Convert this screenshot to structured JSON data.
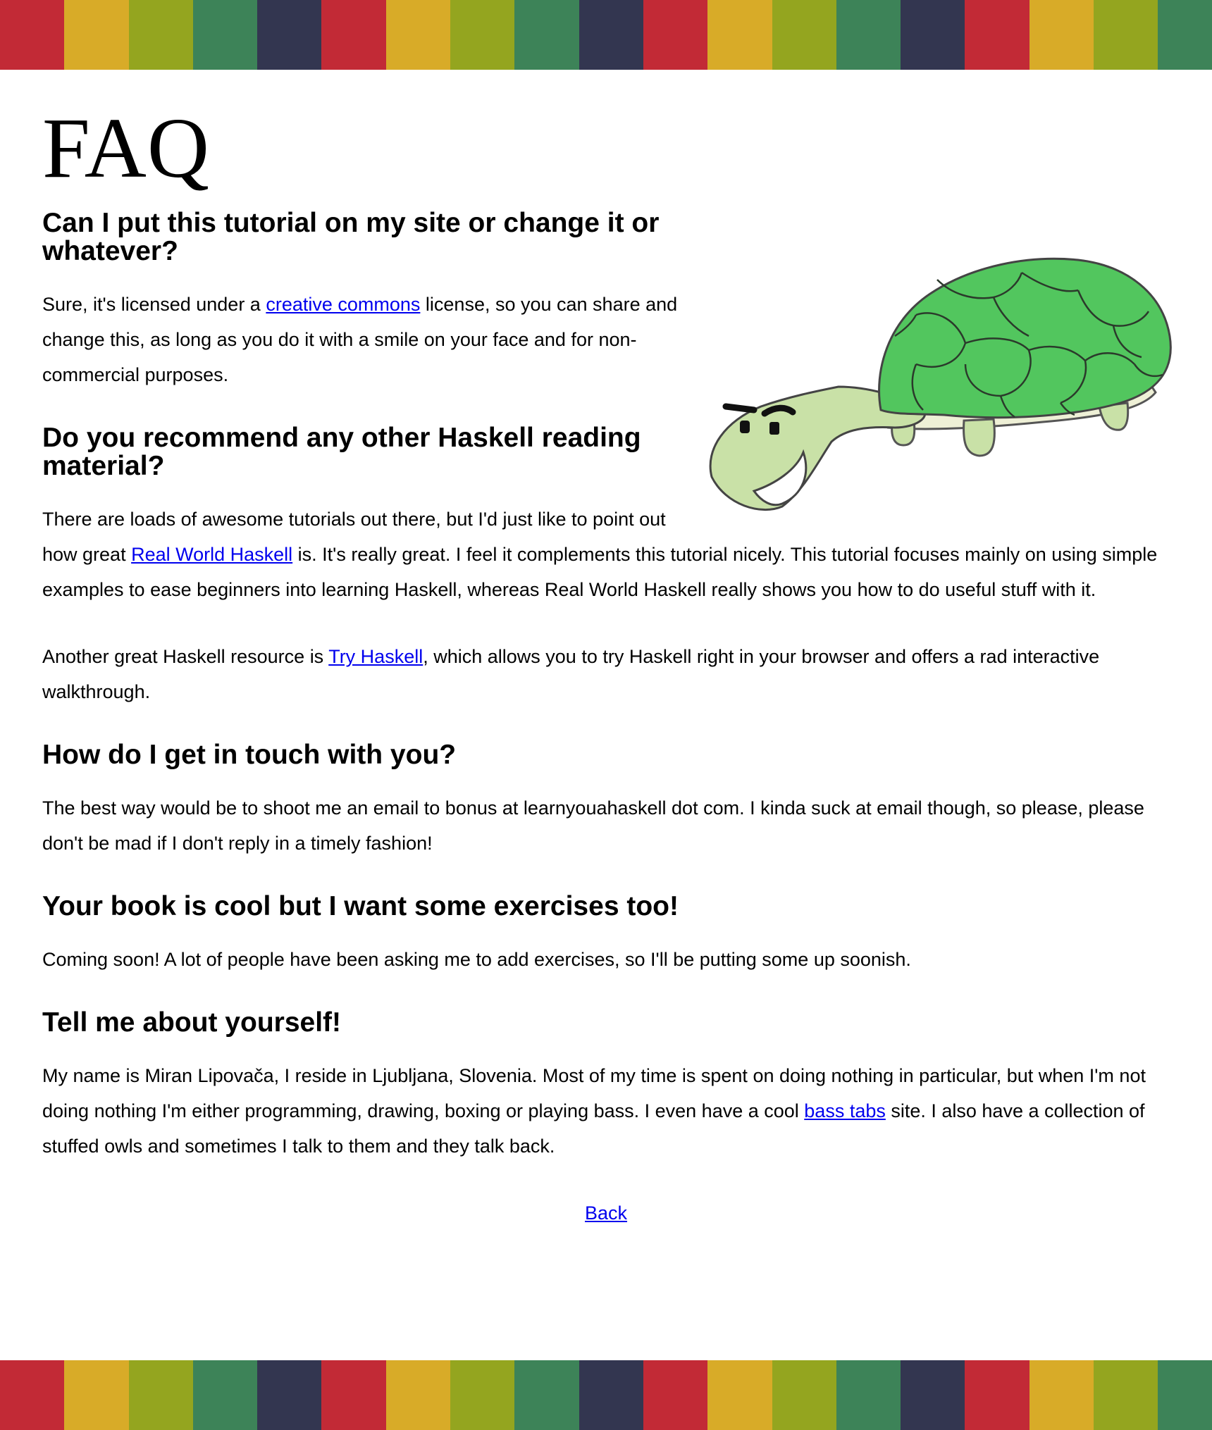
{
  "colors": {
    "stripes": [
      "#c22a36",
      "#d8ab28",
      "#94a51f",
      "#3d8358",
      "#333650",
      "#c22a36",
      "#d8ab28",
      "#94a51f",
      "#3d8358",
      "#333650",
      "#c22a36",
      "#d8ab28",
      "#94a51f",
      "#3d8358",
      "#333650",
      "#c22a36",
      "#d8ab28",
      "#94a51f",
      "#3d8358"
    ],
    "link": "#0000ee",
    "turtle_shell": "#52c65e",
    "turtle_body": "#c9e1a7"
  },
  "page": {
    "title": "FAQ"
  },
  "illustration": {
    "icon": "turtle-icon"
  },
  "faq": {
    "q1": {
      "question": "Can I put this tutorial on my site or change it or whatever?",
      "a_before_link": "Sure, it's licensed under a ",
      "link": "creative commons",
      "a_after_link": " license, so you can share and change this, as long as you do it with a smile on your face and for non-commercial purposes."
    },
    "q2": {
      "question": "Do you recommend any other Haskell reading material?",
      "a1_before_link": "There are loads of awesome tutorials out there, but I'd just like to point out how great ",
      "a1_link": "Real World Haskell",
      "a1_after_link": " is. It's really great. I feel it complements this tutorial nicely. This tutorial focuses mainly on using simple examples to ease beginners into learning Haskell, whereas Real World Haskell really shows you how to do useful stuff with it.",
      "a2_before_link": "Another great Haskell resource is ",
      "a2_link": "Try Haskell",
      "a2_after_link": ", which allows you to try Haskell right in your browser and offers a rad interactive walkthrough."
    },
    "q3": {
      "question": "How do I get in touch with you?",
      "answer": "The best way would be to shoot me an email to bonus at learnyouahaskell dot com. I kinda suck at email though, so please, please don't be mad if I don't reply in a timely fashion!"
    },
    "q4": {
      "question": "Your book is cool but I want some exercises too!",
      "answer": "Coming soon! A lot of people have been asking me to add exercises, so I'll be putting some up soonish."
    },
    "q5": {
      "question": "Tell me about yourself!",
      "a_before_link": "My name is Miran Lipovača, I reside in Ljubljana, Slovenia. Most of my time is spent on doing nothing in particular, but when I'm not doing nothing I'm either programming, drawing, boxing or playing bass. I even have a cool ",
      "link": "bass tabs",
      "a_after_link": " site. I also have a collection of stuffed owls and sometimes I talk to them and they talk back."
    }
  },
  "nav": {
    "back_label": "Back"
  }
}
